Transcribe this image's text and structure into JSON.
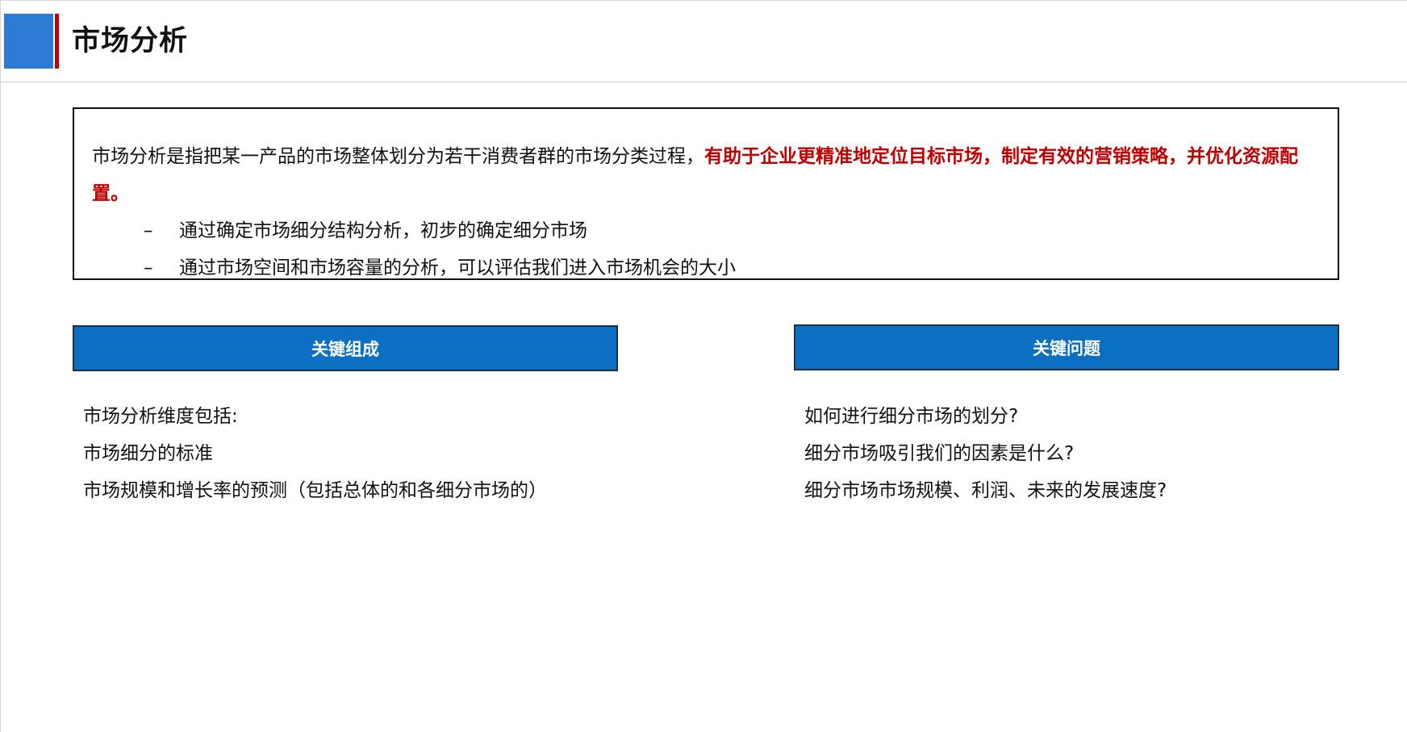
{
  "header": {
    "title": "市场分析"
  },
  "summary": {
    "text_plain": "市场分析是指把某一产品的市场整体划分为若干消费者群的市场分类过程，",
    "text_emphasis": "有助于企业更精准地定位目标市场，制定有效的营销策略，并优化资源配置。",
    "bullets": [
      {
        "dash": "–",
        "text": "通过确定市场细分结构分析，初步的确定细分市场"
      },
      {
        "dash": "–",
        "text": "通过市场空间和市场容量的分析，可以评估我们进入市场机会的大小"
      }
    ]
  },
  "left_section": {
    "heading": "关键组成",
    "items": [
      "市场分析维度包括:",
      "市场细分的标准",
      "市场规模和增长率的预测（包括总体的和各细分市场的）"
    ]
  },
  "right_section": {
    "heading": "关键问题",
    "items": [
      "如何进行细分市场的划分?",
      "细分市场吸引我们的因素是什么?",
      "细分市场市场规模、利润、未来的发展速度?"
    ]
  },
  "colors": {
    "accent_blue": "#2e7bd6",
    "accent_red": "#c00000",
    "header_blue": "#0b6fc2",
    "emphasis_red": "#c00000"
  }
}
